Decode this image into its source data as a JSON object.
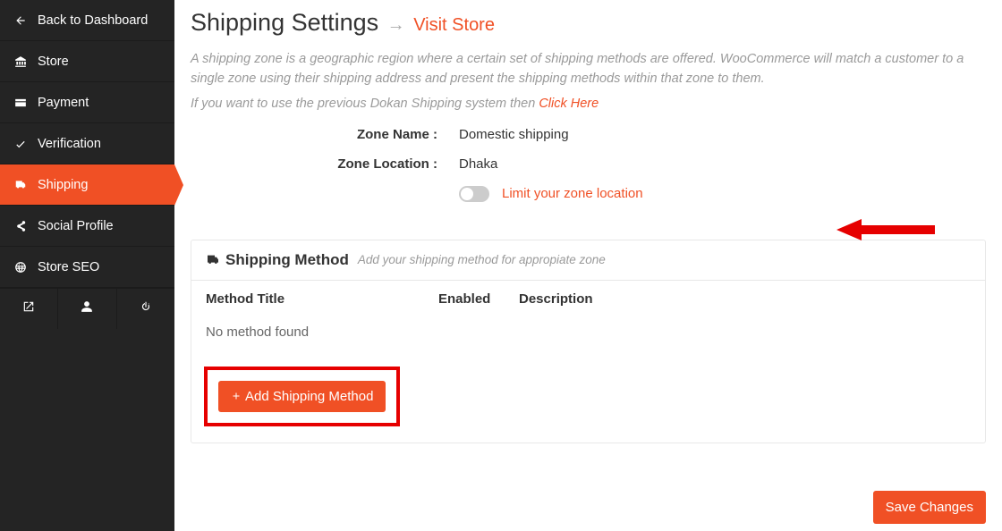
{
  "sidebar": {
    "items": [
      {
        "label": "Back to Dashboard",
        "icon": "arrow-left"
      },
      {
        "label": "Store",
        "icon": "bank"
      },
      {
        "label": "Payment",
        "icon": "card"
      },
      {
        "label": "Verification",
        "icon": "check"
      },
      {
        "label": "Shipping",
        "icon": "truck",
        "active": true
      },
      {
        "label": "Social Profile",
        "icon": "share"
      },
      {
        "label": "Store SEO",
        "icon": "globe"
      }
    ]
  },
  "header": {
    "title": "Shipping Settings",
    "arrow": "→",
    "link_text": "Visit Store"
  },
  "description1": "A shipping zone is a geographic region where a certain set of shipping methods are offered. WooCommerce will match a customer to a single zone using their shipping address and present the shipping methods within that zone to them.",
  "description2_pre": "If you want to use the previous Dokan Shipping system then ",
  "description2_link": "Click Here",
  "zone": {
    "name_label": "Zone Name :",
    "name_value": "Domestic shipping",
    "location_label": "Zone Location :",
    "location_value": "Dhaka",
    "toggle_label": "Limit your zone location"
  },
  "panel": {
    "title": "Shipping Method",
    "subtitle": "Add your shipping method for appropiate zone",
    "columns": {
      "title": "Method Title",
      "enabled": "Enabled",
      "description": "Description"
    },
    "empty": "No method found",
    "add_btn": "Add Shipping Method"
  },
  "save_btn": "Save Changes"
}
